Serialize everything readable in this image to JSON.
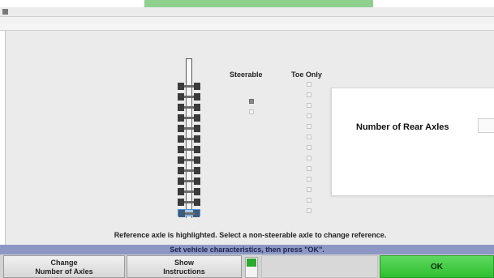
{
  "window": {
    "title": "",
    "menu_label": "",
    "sub_label": ""
  },
  "columns": {
    "steerable": "Steerable",
    "toe_only": "Toe Only"
  },
  "axles": [
    {
      "steerable": false,
      "toe_only": false
    },
    {
      "steerable": false,
      "toe_only": false
    },
    {
      "steerable": true,
      "toe_only": false
    },
    {
      "steerable": false,
      "toe_only": false
    },
    {
      "steerable": false,
      "toe_only": false
    },
    {
      "steerable": false,
      "toe_only": false
    },
    {
      "steerable": false,
      "toe_only": false
    },
    {
      "steerable": false,
      "toe_only": false
    },
    {
      "steerable": false,
      "toe_only": false
    },
    {
      "steerable": false,
      "toe_only": false
    },
    {
      "steerable": false,
      "toe_only": false
    },
    {
      "steerable": false,
      "toe_only": false
    },
    {
      "steerable": false,
      "toe_only": false
    }
  ],
  "reference_axle_index": 12,
  "rear_axles": {
    "label": "Number of Rear Axles",
    "value": ""
  },
  "hint": "Reference axle is highlighted.  Select a non-steerable axle to change reference.",
  "status": "Set vehicle characteristics, then press \"OK\".",
  "buttons": {
    "change_line1": "Change",
    "change_line2": "Number of Axles",
    "show_line1": "Show",
    "show_line2": "Instructions",
    "ok": "OK"
  },
  "colors": {
    "status_bar": "#8c97c4",
    "ok_button": "#3ccb3c",
    "reference_highlight": "#a9c9ea",
    "indicator": "#2ea82e"
  }
}
